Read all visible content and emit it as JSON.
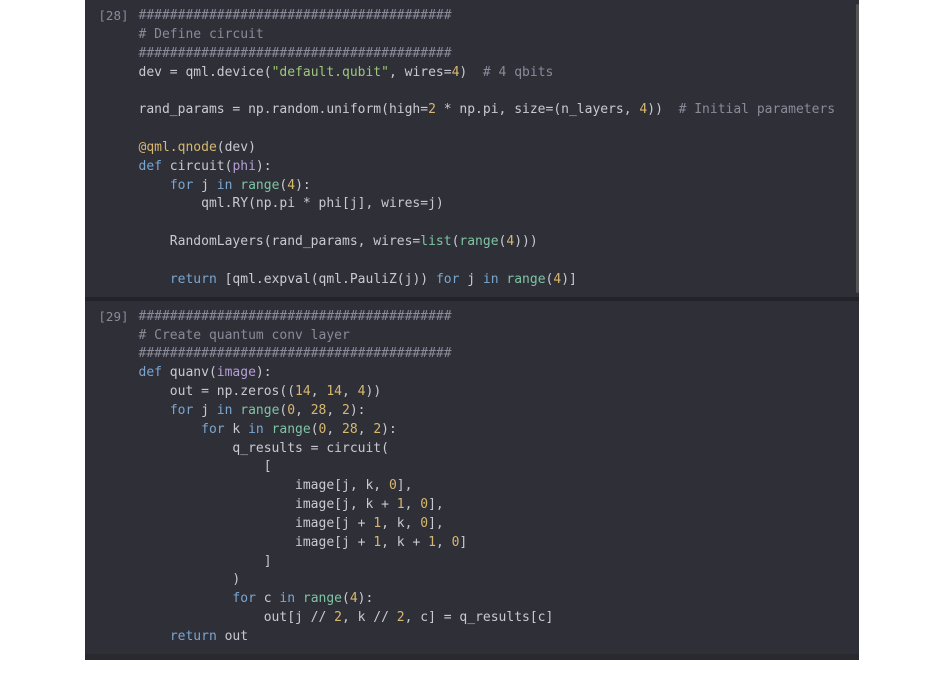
{
  "cells": [
    {
      "prompt": "[28]",
      "lines": [
        [
          [
            "c",
            "########################################"
          ]
        ],
        [
          [
            "c",
            "# Define circuit"
          ]
        ],
        [
          [
            "c",
            "########################################"
          ]
        ],
        [
          [
            "n",
            "dev = qml.device("
          ],
          [
            "s",
            "\"default.qubit\""
          ],
          [
            "n",
            ", wires="
          ],
          [
            "d",
            "4"
          ],
          [
            "n",
            ")  "
          ],
          [
            "c",
            "# 4 qbits"
          ]
        ],
        [
          [
            "n",
            ""
          ]
        ],
        [
          [
            "n",
            "rand_params = np.random.uniform(high="
          ],
          [
            "d",
            "2"
          ],
          [
            "n",
            " * np.pi, size=(n_layers, "
          ],
          [
            "d",
            "4"
          ],
          [
            "n",
            "))  "
          ],
          [
            "c",
            "# Initial parameters"
          ]
        ],
        [
          [
            "n",
            ""
          ]
        ],
        [
          [
            "d",
            "@qml.qnode"
          ],
          [
            "n",
            "(dev)"
          ]
        ],
        [
          [
            "k",
            "def"
          ],
          [
            "n",
            " circuit("
          ],
          [
            "p",
            "phi"
          ],
          [
            "n",
            "):"
          ]
        ],
        [
          [
            "n",
            "    "
          ],
          [
            "k",
            "for"
          ],
          [
            "n",
            " j "
          ],
          [
            "k",
            "in"
          ],
          [
            "n",
            " "
          ],
          [
            "b",
            "range"
          ],
          [
            "n",
            "("
          ],
          [
            "d",
            "4"
          ],
          [
            "n",
            "):"
          ]
        ],
        [
          [
            "n",
            "        qml.RY(np.pi * phi[j], wires=j)"
          ]
        ],
        [
          [
            "n",
            ""
          ]
        ],
        [
          [
            "n",
            "    RandomLayers(rand_params, wires="
          ],
          [
            "b",
            "list"
          ],
          [
            "n",
            "("
          ],
          [
            "b",
            "range"
          ],
          [
            "n",
            "("
          ],
          [
            "d",
            "4"
          ],
          [
            "n",
            ")))"
          ]
        ],
        [
          [
            "n",
            ""
          ]
        ],
        [
          [
            "n",
            "    "
          ],
          [
            "k",
            "return"
          ],
          [
            "n",
            " [qml.expval(qml.PauliZ(j)) "
          ],
          [
            "k",
            "for"
          ],
          [
            "n",
            " j "
          ],
          [
            "k",
            "in"
          ],
          [
            "n",
            " "
          ],
          [
            "b",
            "range"
          ],
          [
            "n",
            "("
          ],
          [
            "d",
            "4"
          ],
          [
            "n",
            ")]"
          ]
        ]
      ],
      "has_scrollbar": true
    },
    {
      "prompt": "[29]",
      "lines": [
        [
          [
            "c",
            "########################################"
          ]
        ],
        [
          [
            "c",
            "# Create quantum conv layer"
          ]
        ],
        [
          [
            "c",
            "########################################"
          ]
        ],
        [
          [
            "k",
            "def"
          ],
          [
            "n",
            " quanv("
          ],
          [
            "p",
            "image"
          ],
          [
            "n",
            "):"
          ]
        ],
        [
          [
            "n",
            "    out = np.zeros(("
          ],
          [
            "d",
            "14"
          ],
          [
            "n",
            ", "
          ],
          [
            "d",
            "14"
          ],
          [
            "n",
            ", "
          ],
          [
            "d",
            "4"
          ],
          [
            "n",
            "))"
          ]
        ],
        [
          [
            "n",
            "    "
          ],
          [
            "k",
            "for"
          ],
          [
            "n",
            " j "
          ],
          [
            "k",
            "in"
          ],
          [
            "n",
            " "
          ],
          [
            "b",
            "range"
          ],
          [
            "n",
            "("
          ],
          [
            "d",
            "0"
          ],
          [
            "n",
            ", "
          ],
          [
            "d",
            "28"
          ],
          [
            "n",
            ", "
          ],
          [
            "d",
            "2"
          ],
          [
            "n",
            "):"
          ]
        ],
        [
          [
            "n",
            "        "
          ],
          [
            "k",
            "for"
          ],
          [
            "n",
            " k "
          ],
          [
            "k",
            "in"
          ],
          [
            "n",
            " "
          ],
          [
            "b",
            "range"
          ],
          [
            "n",
            "("
          ],
          [
            "d",
            "0"
          ],
          [
            "n",
            ", "
          ],
          [
            "d",
            "28"
          ],
          [
            "n",
            ", "
          ],
          [
            "d",
            "2"
          ],
          [
            "n",
            "):"
          ]
        ],
        [
          [
            "n",
            "            q_results = circuit("
          ]
        ],
        [
          [
            "n",
            "                ["
          ]
        ],
        [
          [
            "n",
            "                    image[j, k, "
          ],
          [
            "d",
            "0"
          ],
          [
            "n",
            "],"
          ]
        ],
        [
          [
            "n",
            "                    image[j, k + "
          ],
          [
            "d",
            "1"
          ],
          [
            "n",
            ", "
          ],
          [
            "d",
            "0"
          ],
          [
            "n",
            "],"
          ]
        ],
        [
          [
            "n",
            "                    image[j + "
          ],
          [
            "d",
            "1"
          ],
          [
            "n",
            ", k, "
          ],
          [
            "d",
            "0"
          ],
          [
            "n",
            "],"
          ]
        ],
        [
          [
            "n",
            "                    image[j + "
          ],
          [
            "d",
            "1"
          ],
          [
            "n",
            ", k + "
          ],
          [
            "d",
            "1"
          ],
          [
            "n",
            ", "
          ],
          [
            "d",
            "0"
          ],
          [
            "n",
            "]"
          ]
        ],
        [
          [
            "n",
            "                ]"
          ]
        ],
        [
          [
            "n",
            "            )"
          ]
        ],
        [
          [
            "n",
            "            "
          ],
          [
            "k",
            "for"
          ],
          [
            "n",
            " c "
          ],
          [
            "k",
            "in"
          ],
          [
            "n",
            " "
          ],
          [
            "b",
            "range"
          ],
          [
            "n",
            "("
          ],
          [
            "d",
            "4"
          ],
          [
            "n",
            "):"
          ]
        ],
        [
          [
            "n",
            "                out[j // "
          ],
          [
            "d",
            "2"
          ],
          [
            "n",
            ", k // "
          ],
          [
            "d",
            "2"
          ],
          [
            "n",
            ", c] = q_results[c]"
          ]
        ],
        [
          [
            "n",
            "    "
          ],
          [
            "k",
            "return"
          ],
          [
            "n",
            " out"
          ]
        ]
      ],
      "has_scrollbar": false
    }
  ]
}
